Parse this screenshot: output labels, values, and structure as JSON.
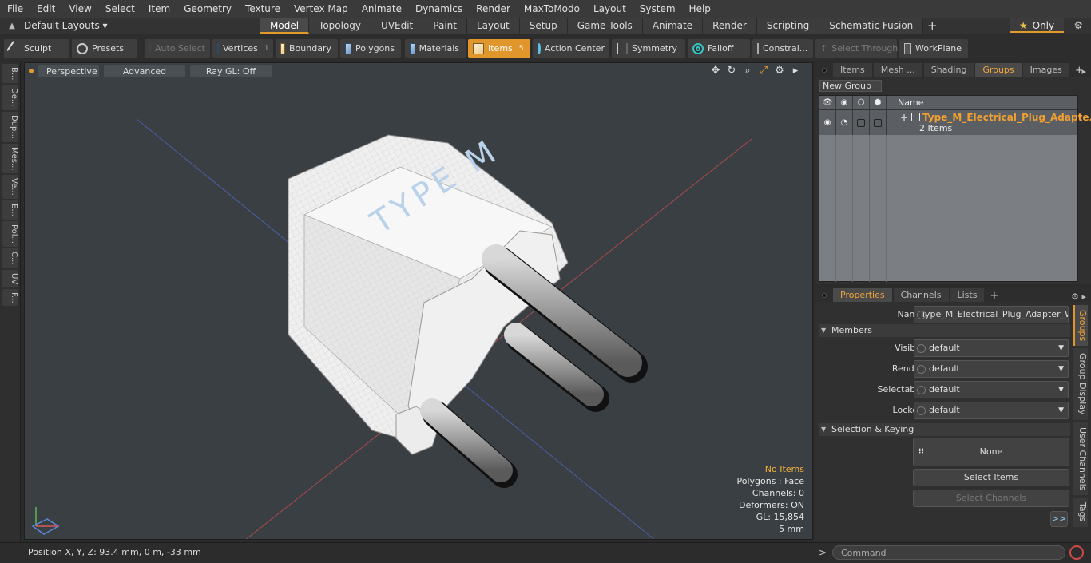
{
  "menubar": [
    "File",
    "Edit",
    "View",
    "Select",
    "Item",
    "Geometry",
    "Texture",
    "Vertex Map",
    "Animate",
    "Dynamics",
    "Render",
    "MaxToModo",
    "Layout",
    "System",
    "Help"
  ],
  "layout": {
    "default_layouts": "Default Layouts ▾",
    "tabs": [
      "Model",
      "Topology",
      "UVEdit",
      "Paint",
      "Layout",
      "Setup",
      "Game Tools",
      "Animate",
      "Render",
      "Scripting",
      "Schematic Fusion"
    ],
    "active_tab": "Model",
    "only_label": "Only"
  },
  "toolbar": {
    "sculpt": "Sculpt",
    "presets": "Presets",
    "auto_select": "Auto Select",
    "vertices": "Vertices",
    "vertices_count": "1",
    "boundary": "Boundary",
    "polygons": "Polygons",
    "materials": "Materials",
    "items": "Items",
    "items_count": "5",
    "action_center": "Action Center",
    "symmetry": "Symmetry",
    "falloff": "Falloff",
    "constraints": "Constrai...",
    "select_through": "Select Through",
    "workplane": "WorkPlane"
  },
  "left_tabs": [
    "B...",
    "De...",
    "Dup...",
    "Mes...",
    "Ve...",
    "E...",
    "Pol...",
    "C...",
    "UV",
    "F..."
  ],
  "viewport": {
    "perspective": "Perspective",
    "advanced": "Advanced",
    "ray_gl": "Ray GL: Off",
    "model_text": "TYPE M",
    "stats": {
      "items": "No Items",
      "polygons": "Polygons : Face",
      "channels": "Channels: 0",
      "deformers": "Deformers: ON",
      "gl": "GL: 15,854",
      "scale": "5 mm"
    }
  },
  "status": {
    "position": "Position X, Y, Z:   93.4 mm, 0 m, -33 mm",
    "command_placeholder": "Command"
  },
  "groups_panel": {
    "tabs": [
      "Items",
      "Mesh ...",
      "Shading",
      "Groups",
      "Images"
    ],
    "active_tab": "Groups",
    "new_group": "New Group",
    "name_header": "Name",
    "group_name": "Type_M_Electrical_Plug_Adapte...",
    "group_count": "2 Items"
  },
  "properties_panel": {
    "tabs": [
      "Properties",
      "Channels",
      "Lists"
    ],
    "active_tab": "Properties",
    "name_label": "Name",
    "name_value": "Type_M_Electrical_Plug_Adapter_Whi",
    "members_section": "Members",
    "rows": [
      {
        "label": "Visible",
        "value": "default"
      },
      {
        "label": "Render",
        "value": "default"
      },
      {
        "label": "Selectable",
        "value": "default"
      },
      {
        "label": "Locked",
        "value": "default"
      }
    ],
    "selection_section": "Selection & Keying",
    "none_label": "None",
    "select_items": "Select Items",
    "select_channels": "Select Channels",
    "more": ">>",
    "side_tabs": [
      "Groups",
      "Group Display",
      "User Channels",
      "Tags"
    ]
  },
  "colors": {
    "accent": "#e0962b",
    "group_name": "#f0a030",
    "viewport_bg": "#3a3f43"
  }
}
